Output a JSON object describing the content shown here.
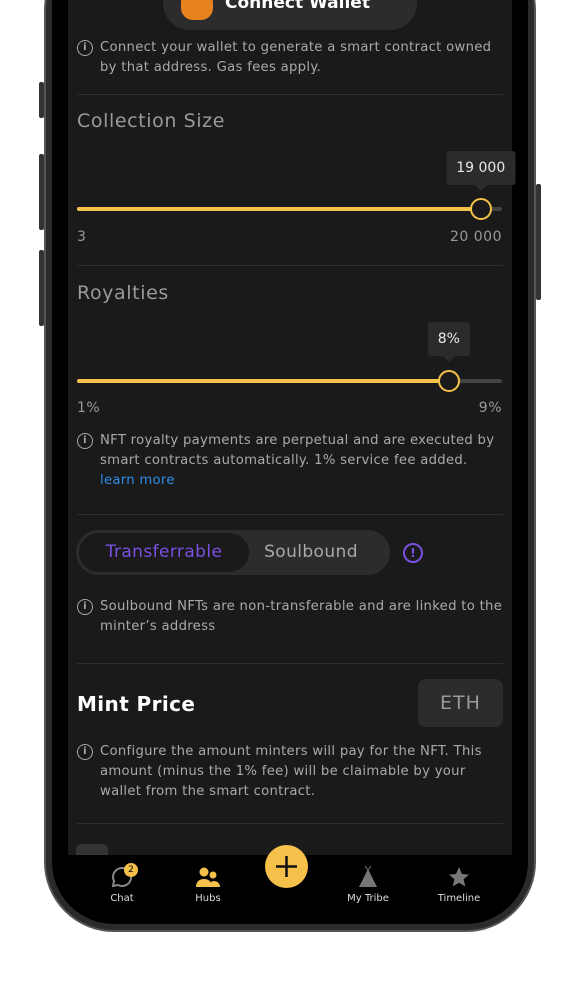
{
  "wallet": {
    "connect_label": "Connect Wallet",
    "info": "Connect your wallet to generate a smart contract owned by that address. Gas fees apply."
  },
  "collection_size": {
    "title": "Collection Size",
    "value": 19000,
    "value_label": "19 000",
    "min": 3,
    "max": 20000,
    "min_label": "3",
    "max_label": "20 000"
  },
  "royalties": {
    "title": "Royalties",
    "value": 8,
    "value_label": "8%",
    "min": 1,
    "max": 9,
    "min_label": "1%",
    "max_label": "9%",
    "info": "NFT royalty payments are perpetual and are executed by smart contracts automatically. 1% service fee added.",
    "learn_more": "learn more"
  },
  "transfer_toggle": {
    "options": [
      "Transferrable",
      "Soulbound"
    ],
    "selected": "Transferrable",
    "info": "Soulbound NFTs are non-transferable and are linked to the minter’s address"
  },
  "mint_price": {
    "title": "Mint Price",
    "currency": "ETH",
    "info": "Configure the amount minters will pay for the NFT. This amount (minus the 1% fee) will be claimable by your wallet from the smart contract."
  },
  "nav": {
    "items": [
      {
        "label": "Chat",
        "badge": "2",
        "icon": "chat-icon"
      },
      {
        "label": "Hubs",
        "icon": "users-icon"
      },
      {
        "label": "",
        "icon": "plus-icon"
      },
      {
        "label": "My Tribe",
        "icon": "tent-icon"
      },
      {
        "label": "Timeline",
        "icon": "star-icon"
      }
    ]
  },
  "colors": {
    "accent": "#f5c14a",
    "purple": "#7b4fe0",
    "link": "#2f8ce6",
    "background": "#1a1a1a"
  }
}
